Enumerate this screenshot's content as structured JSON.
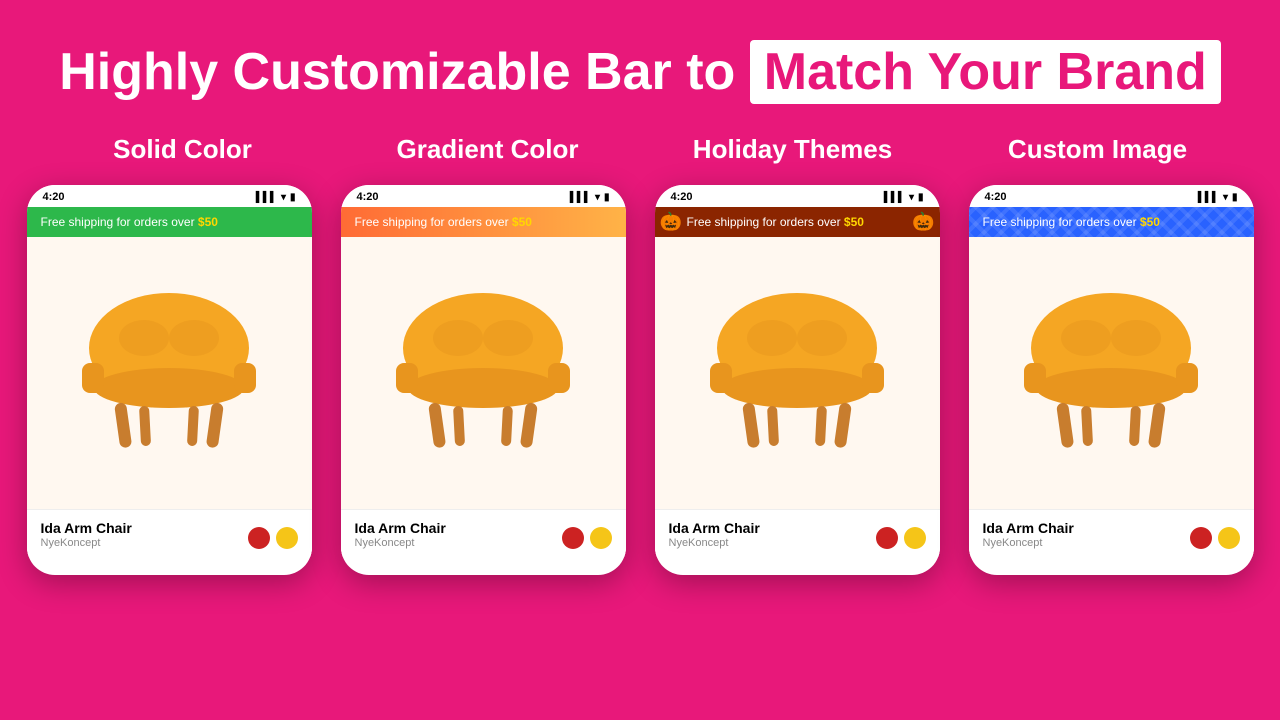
{
  "header": {
    "title_main": "Highly Customizable Bar to",
    "title_highlight": "Match Your Brand"
  },
  "categories": [
    {
      "id": "solid-color",
      "label": "Solid Color"
    },
    {
      "id": "gradient-color",
      "label": "Gradient Color"
    },
    {
      "id": "holiday-themes",
      "label": "Holiday Themes"
    },
    {
      "id": "custom-image",
      "label": "Custom Image"
    }
  ],
  "phones": [
    {
      "id": "phone-solid",
      "time": "4:20",
      "bar_type": "solid",
      "bar_text": "Free shipping for orders over",
      "bar_price": "$50",
      "product": "Ida Arm Chair",
      "brand": "NyeKoncept"
    },
    {
      "id": "phone-gradient",
      "time": "4:20",
      "bar_type": "gradient",
      "bar_text": "Free shipping for orders over",
      "bar_price": "$50",
      "product": "Ida Arm Chair",
      "brand": "NyeKoncept"
    },
    {
      "id": "phone-holiday",
      "time": "4:20",
      "bar_type": "holiday",
      "bar_text": "Free shipping for orders over",
      "bar_price": "$50",
      "product": "Ida Arm Chair",
      "brand": "NyeKoncept"
    },
    {
      "id": "phone-custom",
      "time": "4:20",
      "bar_type": "custom",
      "bar_text": "Free shipping for orders over",
      "bar_price": "$50",
      "product": "Ida Arm Chair",
      "brand": "NyeKoncept"
    }
  ],
  "colors": {
    "background": "#E8187A",
    "highlight_bg": "#FFFFFF",
    "highlight_text": "#E8187A"
  }
}
